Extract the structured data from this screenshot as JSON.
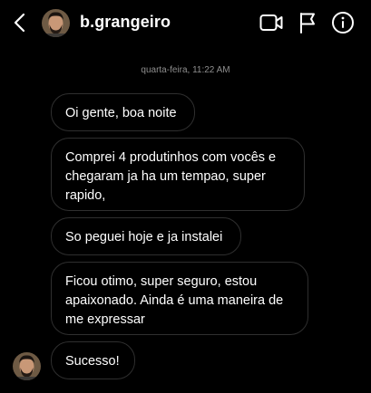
{
  "header": {
    "username": "b.grangeiro",
    "icons": {
      "back": "chevron-left-icon",
      "video": "video-call-icon",
      "flag": "flag-icon",
      "info": "info-icon"
    }
  },
  "chat": {
    "timestamp": "quarta-feira, 11:22 AM",
    "messages": [
      {
        "text": "Oi gente, boa noite"
      },
      {
        "text": "Comprei 4 produtinhos com vocês e chegaram ja ha um tempao, super rapido,"
      },
      {
        "text": "So peguei hoje e ja instalei"
      },
      {
        "text": "Ficou otimo, super seguro, estou apaixonado. Ainda é uma maneira de me expressar"
      },
      {
        "text": "Sucesso!"
      }
    ]
  },
  "colors": {
    "background": "#000000",
    "bubble_border": "#2f2f2f",
    "text": "#ffffff",
    "timestamp": "#8e8e8e"
  }
}
